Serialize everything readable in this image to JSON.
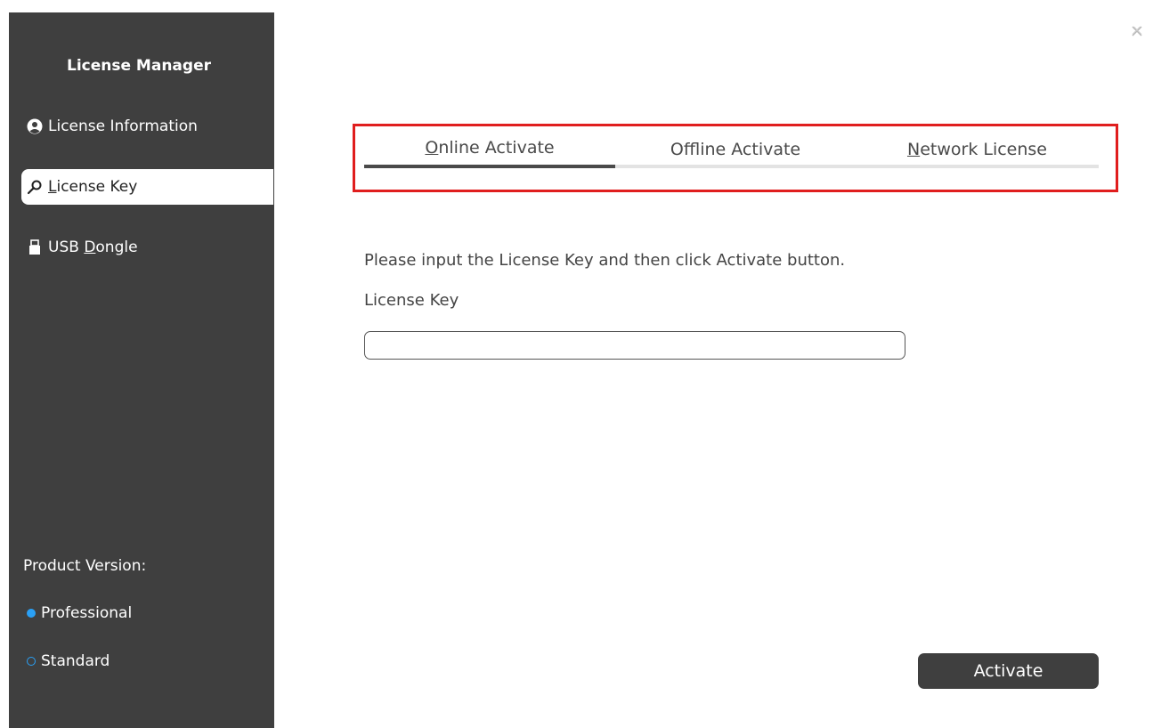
{
  "sidebar": {
    "title": "License Manager",
    "items": [
      {
        "label": "License Information",
        "icon": "user-circle-icon",
        "active": false
      },
      {
        "label_prefix": "",
        "label_mnemonic": "L",
        "label_rest": "icense Key",
        "icon": "key-icon",
        "active": true
      },
      {
        "label_prefix": "USB ",
        "label_mnemonic": "D",
        "label_rest": "ongle",
        "icon": "usb-drive-icon",
        "active": false
      }
    ],
    "product_version": {
      "label": "Product Version:",
      "options": [
        {
          "label": "Professional",
          "selected": true
        },
        {
          "label": "Standard",
          "selected": false
        }
      ]
    }
  },
  "tabs": [
    {
      "mnemonic": "O",
      "rest": "nline Activate",
      "prefix": "",
      "active": true
    },
    {
      "prefix": "Of",
      "mnemonic": "f",
      "rest": "line Activate",
      "active": false
    },
    {
      "prefix": "",
      "mnemonic": "N",
      "rest": "etwork License",
      "active": false
    }
  ],
  "main": {
    "instruction": "Please input the License Key and then click Activate button.",
    "license_key_label": "License Key",
    "license_key_value": "",
    "license_key_placeholder": "",
    "activate_label": "Activate"
  },
  "colors": {
    "sidebar_bg": "#3f3f3f",
    "accent_blue": "#2aa0f5",
    "highlight_red": "#e01e1e"
  }
}
